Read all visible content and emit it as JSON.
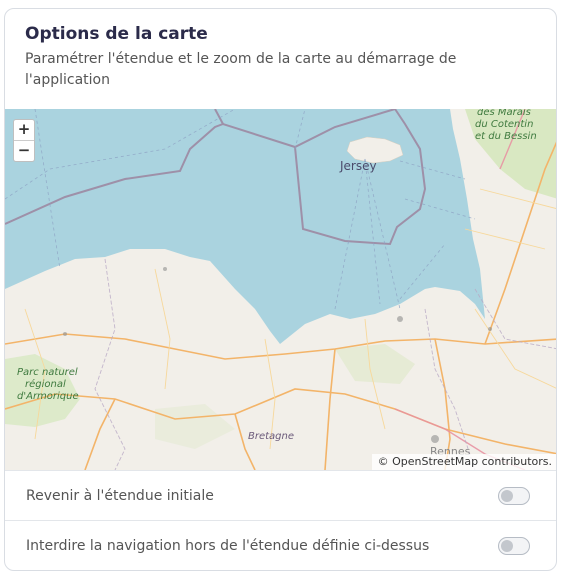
{
  "header": {
    "title": "Options de la carte",
    "subtitle": "Paramétrer l'étendue et le zoom de la carte au démarrage de l'application"
  },
  "map": {
    "zoom_in": "+",
    "zoom_out": "−",
    "attribution": "© OpenStreetMap contributors.",
    "labels": {
      "jersey": "Jersey",
      "marais_1": "des Marais",
      "marais_2": "du Cotentin",
      "marais_3": "et du Bessin",
      "parc_1": "Parc naturel",
      "parc_2": "régional",
      "parc_3": "d'Armorique",
      "bretagne": "Bretagne",
      "rennes": "Rennes"
    },
    "colors": {
      "sea": "#aad3df",
      "land": "#f2efe9",
      "border": "#9e90a8",
      "road": "#f3b469"
    }
  },
  "options": [
    {
      "label": "Revenir à l'étendue initiale",
      "enabled": false
    },
    {
      "label": "Interdire la navigation hors de l'étendue définie ci-dessus",
      "enabled": false
    }
  ]
}
